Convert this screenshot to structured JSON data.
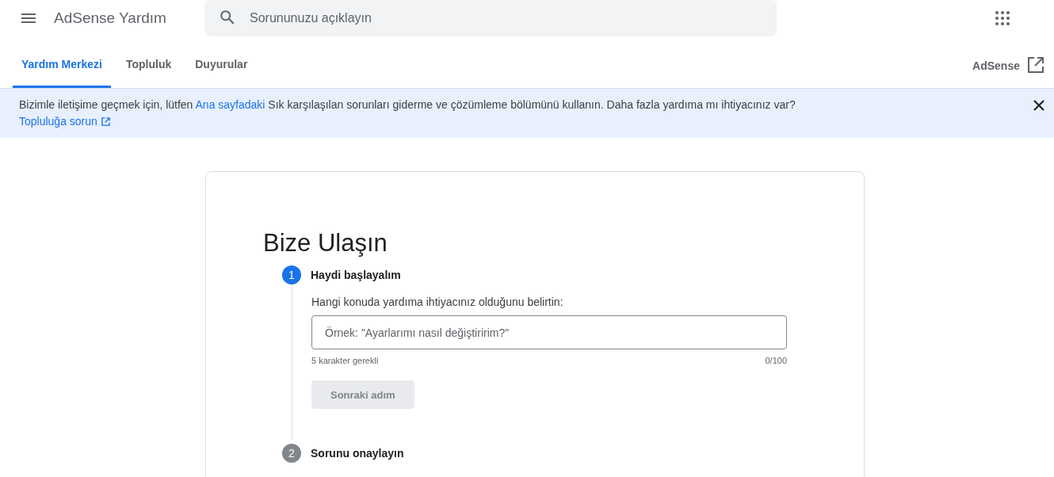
{
  "header": {
    "title": "AdSense Yardım",
    "search": {
      "placeholder": "Sorununuzu açıklayın"
    }
  },
  "tabs": [
    {
      "label": "Yardım Merkezi",
      "selected": true
    },
    {
      "label": "Topluluk",
      "selected": false
    },
    {
      "label": "Duyurular",
      "selected": false
    }
  ],
  "product_link": "AdSense",
  "banner": {
    "text_before": "Bizimle iletişime geçmek için, lütfen",
    "link": "Ana sayfadaki",
    "text_after": "Sık karşılaşılan sorunları giderme ve çözümleme bölümünü kullanın. Daha fazla yardıma mı ihtiyacınız var?",
    "community_link": "Topluluğa sorun"
  },
  "form": {
    "title": "Bize Ulaşın",
    "steps": [
      {
        "number": "1",
        "label": "Haydi başlayalım",
        "active": true,
        "prompt": "Hangi konuda yardıma ihtiyacınız olduğunu belirtin:",
        "input": {
          "placeholder": "Örnek: \"Ayarlarımı nasıl değiştiririm?\""
        },
        "hint": "5 karakter gerekli",
        "counter": "0/100",
        "button": {
          "label": "Sonraki adım",
          "disabled": true
        }
      },
      {
        "number": "2",
        "label": "Sorunu onaylayın",
        "active": false
      }
    ]
  }
}
